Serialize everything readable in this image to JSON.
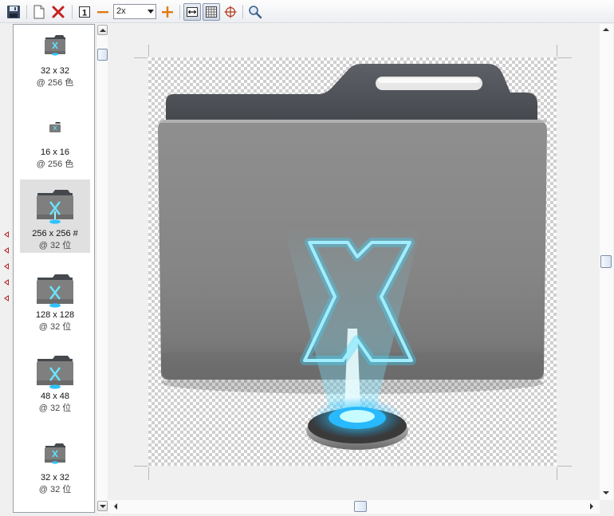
{
  "toolbar": {
    "zoom_value": "2x",
    "zoom_options": [
      "2x"
    ],
    "buttons": [
      "save-icon",
      "new-page-icon",
      "delete-icon",
      "actual-size-icon",
      "zoom-out-icon",
      "zoom-in-icon",
      "fit-width-icon",
      "grid-icon",
      "crosshair-icon",
      "search-icon"
    ]
  },
  "thumbnails": [
    {
      "size": "32 x 32",
      "depth": "@ 256 色",
      "selected": false
    },
    {
      "size": "16 x 16",
      "depth": "@ 256 色",
      "selected": false
    },
    {
      "size": "256 x 256 #",
      "depth": "@ 32 位",
      "selected": true
    },
    {
      "size": "128 x 128",
      "depth": "@ 32 位",
      "selected": false
    },
    {
      "size": "48 x 48",
      "depth": "@ 32 位",
      "selected": false
    },
    {
      "size": "32 x 32",
      "depth": "@ 32 位",
      "selected": false
    }
  ],
  "colors": {
    "accent_red": "#b42727",
    "glow_cyan": "#3ad6ff",
    "folder_grey": "#8a8a8a",
    "folder_tab": "#4a4d52"
  },
  "canvas": {
    "icon": "folder-with-glowing-x-hologram-icon"
  }
}
